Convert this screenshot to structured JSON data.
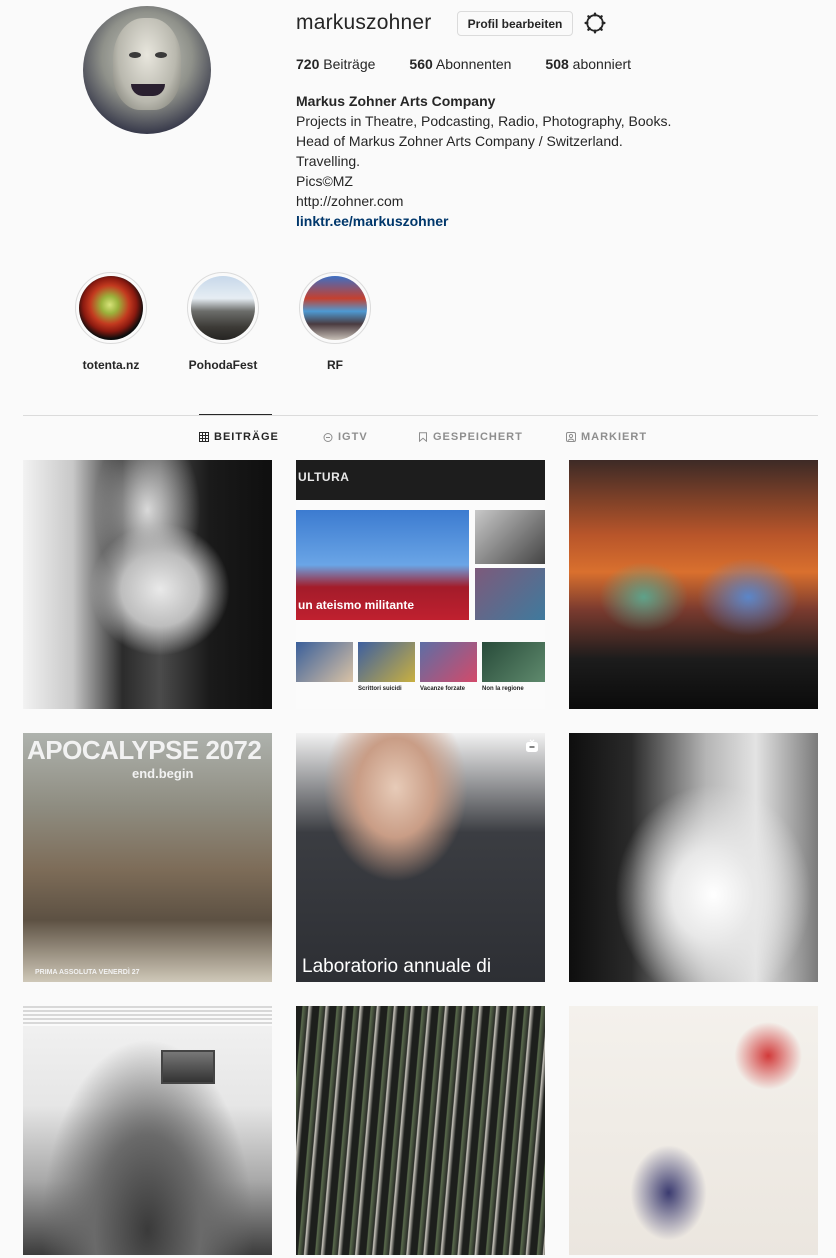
{
  "profile": {
    "username": "markuszohner",
    "edit_label": "Profil bearbeiten",
    "settings_icon": "gear-icon",
    "stats": {
      "posts_count": "720",
      "posts_label": "Beiträge",
      "followers_count": "560",
      "followers_label": "Abonnenten",
      "following_count": "508",
      "following_label": "abonniert"
    },
    "bio": {
      "name": "Markus Zohner Arts Company",
      "lines": [
        "Projects in Theatre, Podcasting, Radio, Photography, Books.",
        "Head of Markus Zohner Arts Company / Switzerland.",
        "Travelling.",
        "Pics©MZ",
        "http://zohner.com"
      ],
      "link": "linktr.ee/markuszohner"
    }
  },
  "highlights": [
    {
      "label": "totenta.nz"
    },
    {
      "label": "PohodaFest"
    },
    {
      "label": "RF"
    }
  ],
  "tabs": [
    {
      "label": "BEITRÄGE",
      "icon": "grid-icon",
      "active": true
    },
    {
      "label": "IGTV",
      "icon": "igtv-icon",
      "active": false
    },
    {
      "label": "GESPEICHERT",
      "icon": "bookmark-icon",
      "active": false
    },
    {
      "label": "MARKIERT",
      "icon": "tagged-icon",
      "active": false
    }
  ],
  "posts": {
    "p2": {
      "header": "ULTURA",
      "headline": "un ateismo militante",
      "cards": [
        "Scrittori suicidi",
        "Vacanze forzate",
        "Non la regione"
      ]
    },
    "p4": {
      "title": "APOCALYPSE 2072",
      "subtitle": "end.begin",
      "bottom": "PRIMA ASSOLUTA VENERDÌ 27"
    },
    "p5": {
      "caption": "Laboratorio annuale di"
    }
  }
}
